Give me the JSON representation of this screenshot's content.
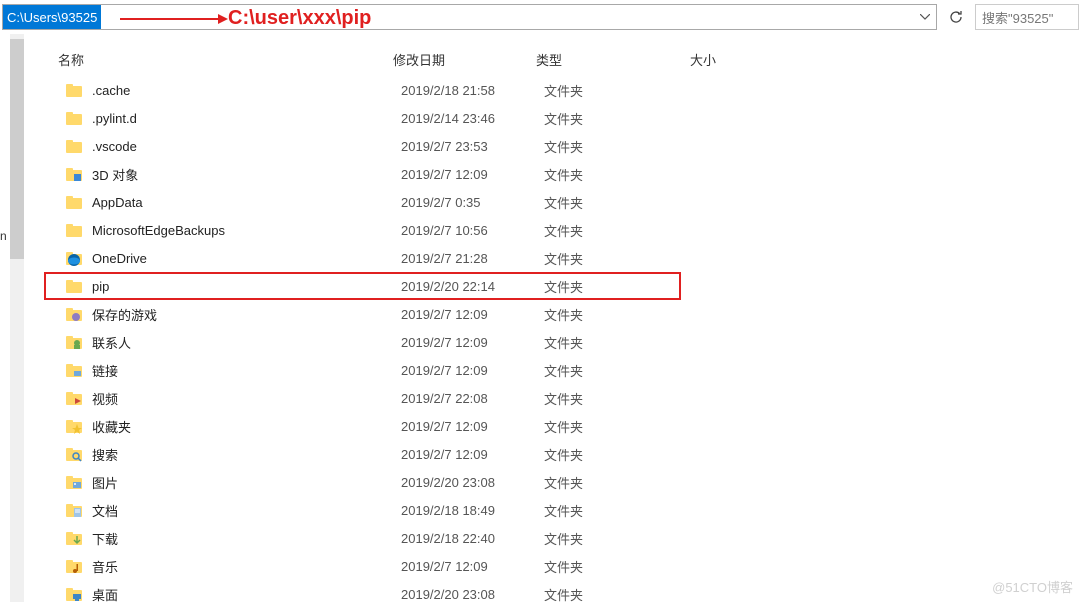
{
  "addressBar": {
    "path": "C:\\Users\\93525"
  },
  "annotation": {
    "text": "C:\\user\\xxx\\pip"
  },
  "search": {
    "placeholder": "搜索\"93525\""
  },
  "columns": {
    "name": "名称",
    "date": "修改日期",
    "type": "类型",
    "size": "大小"
  },
  "partialLeft": "n",
  "files": [
    {
      "icon": "folder",
      "name": ".cache",
      "date": "2019/2/18 21:58",
      "type": "文件夹",
      "highlighted": false
    },
    {
      "icon": "folder",
      "name": ".pylint.d",
      "date": "2019/2/14 23:46",
      "type": "文件夹",
      "highlighted": false
    },
    {
      "icon": "folder",
      "name": ".vscode",
      "date": "2019/2/7 23:53",
      "type": "文件夹",
      "highlighted": false
    },
    {
      "icon": "3d",
      "name": "3D 对象",
      "date": "2019/2/7 12:09",
      "type": "文件夹",
      "highlighted": false
    },
    {
      "icon": "folder",
      "name": "AppData",
      "date": "2019/2/7 0:35",
      "type": "文件夹",
      "highlighted": false
    },
    {
      "icon": "folder",
      "name": "MicrosoftEdgeBackups",
      "date": "2019/2/7 10:56",
      "type": "文件夹",
      "highlighted": false
    },
    {
      "icon": "onedrive",
      "name": "OneDrive",
      "date": "2019/2/7 21:28",
      "type": "文件夹",
      "highlighted": false
    },
    {
      "icon": "folder",
      "name": "pip",
      "date": "2019/2/20 22:14",
      "type": "文件夹",
      "highlighted": true
    },
    {
      "icon": "games",
      "name": "保存的游戏",
      "date": "2019/2/7 12:09",
      "type": "文件夹",
      "highlighted": false
    },
    {
      "icon": "contacts",
      "name": "联系人",
      "date": "2019/2/7 12:09",
      "type": "文件夹",
      "highlighted": false
    },
    {
      "icon": "links",
      "name": "链接",
      "date": "2019/2/7 12:09",
      "type": "文件夹",
      "highlighted": false
    },
    {
      "icon": "videos",
      "name": "视频",
      "date": "2019/2/7 22:08",
      "type": "文件夹",
      "highlighted": false
    },
    {
      "icon": "favorites",
      "name": "收藏夹",
      "date": "2019/2/7 12:09",
      "type": "文件夹",
      "highlighted": false
    },
    {
      "icon": "search",
      "name": "搜索",
      "date": "2019/2/7 12:09",
      "type": "文件夹",
      "highlighted": false
    },
    {
      "icon": "pictures",
      "name": "图片",
      "date": "2019/2/20 23:08",
      "type": "文件夹",
      "highlighted": false
    },
    {
      "icon": "documents",
      "name": "文档",
      "date": "2019/2/18 18:49",
      "type": "文件夹",
      "highlighted": false
    },
    {
      "icon": "downloads",
      "name": "下载",
      "date": "2019/2/18 22:40",
      "type": "文件夹",
      "highlighted": false
    },
    {
      "icon": "music",
      "name": "音乐",
      "date": "2019/2/7 12:09",
      "type": "文件夹",
      "highlighted": false
    },
    {
      "icon": "desktop",
      "name": "桌面",
      "date": "2019/2/20 23:08",
      "type": "文件夹",
      "highlighted": false
    }
  ],
  "watermark": "@51CTO博客"
}
